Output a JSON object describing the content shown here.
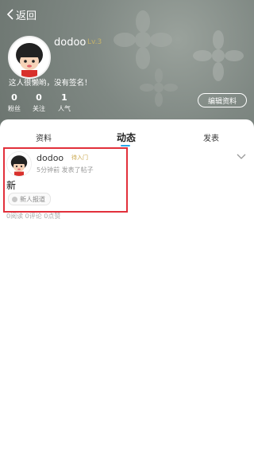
{
  "nav": {
    "back_label": "返回"
  },
  "profile": {
    "username": "dodoo",
    "level_badge": "Lv.3",
    "signature": "这人很懒哟，没有签名！",
    "stats": [
      {
        "value": "0",
        "label": "粉丝"
      },
      {
        "value": "0",
        "label": "关注"
      },
      {
        "value": "1",
        "label": "人气"
      }
    ],
    "edit_button": "编辑资料"
  },
  "tabs": [
    {
      "label": "资料",
      "active": false
    },
    {
      "label": "动态",
      "active": true
    },
    {
      "label": "发表",
      "active": false
    }
  ],
  "post": {
    "username": "dodoo",
    "level": "待入门",
    "time_action": "5分钟前 发表了帖子",
    "text": "新",
    "tag": "新人报道",
    "stats": "0阅读 0评论 0点赞"
  },
  "colors": {
    "accent": "#2aa5e8",
    "highlight": "#e2303b",
    "header_bg": "#7f8883"
  },
  "icons": [
    "back-arrow-icon",
    "chevron-down-icon",
    "tag-dot-icon"
  ]
}
